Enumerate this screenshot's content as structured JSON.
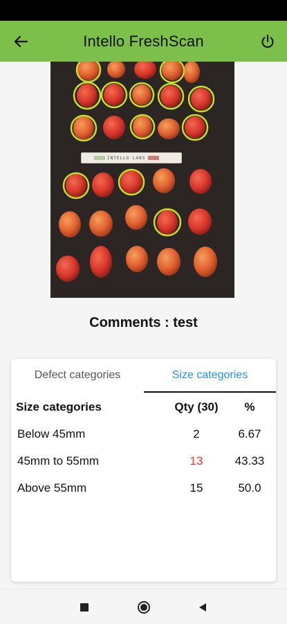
{
  "app_bar": {
    "title": "Intello FreshScan",
    "back_icon": "arrow-left-icon",
    "power_icon": "power-icon",
    "background": "#7cbf4a"
  },
  "photo": {
    "tag_text": "INTELLO LABS"
  },
  "comments": {
    "text": "Comments : test"
  },
  "tabs": [
    {
      "label": "Defect categories",
      "active": false
    },
    {
      "label": "Size categories",
      "active": true
    }
  ],
  "table": {
    "headers": [
      "Size categories",
      "Qty (30)",
      "%"
    ],
    "rows": [
      {
        "category": "Below 45mm",
        "qty": "2",
        "percent": "6.67"
      },
      {
        "category": "45mm to 55mm",
        "qty": "13",
        "percent": "43.33"
      },
      {
        "category": "Above 55mm",
        "qty": "15",
        "percent": "50.0"
      }
    ]
  },
  "colors": {
    "accent_tab": "#2a8cf4",
    "highlight_qty": "#e53935",
    "ring": "#c7e02e"
  },
  "nav_bar": {
    "icons": [
      "recent-apps-icon",
      "home-icon",
      "back-triangle-icon"
    ]
  }
}
